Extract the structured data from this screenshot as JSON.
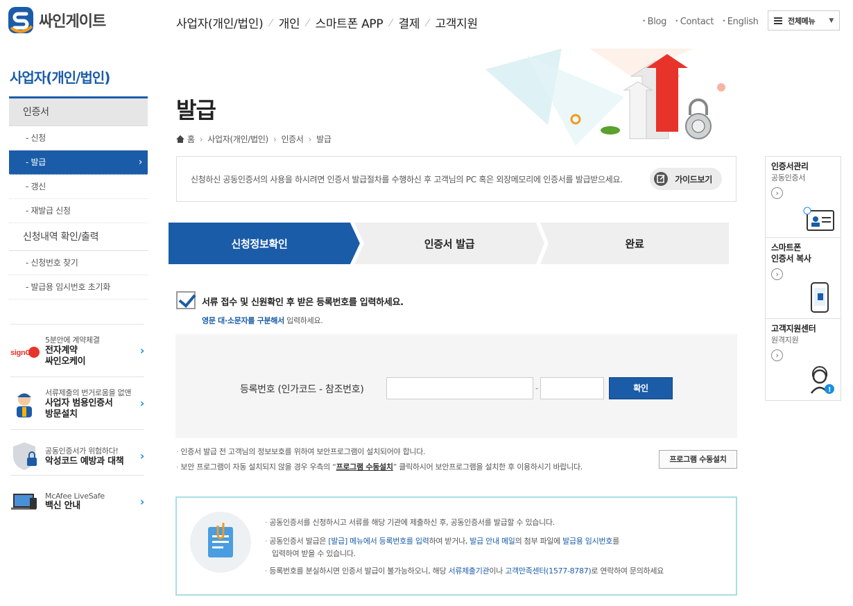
{
  "header": {
    "logo_text": "싸인게이트",
    "gnb": [
      "사업자(개인/법인)",
      "개인",
      "스마트폰 APP",
      "결제",
      "고객지원"
    ],
    "util": [
      "Blog",
      "Contact",
      "English"
    ],
    "all_menu": "전체메뉴"
  },
  "lnb": {
    "title": "사업자(개인/법인)",
    "items": [
      {
        "label": "인증서"
      },
      {
        "label": "- 신청"
      },
      {
        "label": "- 발급"
      },
      {
        "label": "- 갱신"
      },
      {
        "label": "- 재발급 신청"
      },
      {
        "label": "신청내역 확인/출력"
      },
      {
        "label": "- 신청번호 찾기"
      },
      {
        "label": "- 발급용 임시번호 초기화"
      }
    ]
  },
  "banners": [
    {
      "small": "5분안에 계약체결",
      "big1": "전자계약",
      "big2": "싸인오케이",
      "arrow": "›",
      "logo": "signOK"
    },
    {
      "small": "서류제출의 번거로움을 없앤",
      "big1": "사업자 범용인증서",
      "big2": "방문설치",
      "arrow": "›"
    },
    {
      "small": "공동인증서가 위험하다!",
      "big1": "악성코드 예방과 대책",
      "big2": "",
      "arrow": "›"
    },
    {
      "small": "McAfee LiveSafe",
      "big1": "백신 안내",
      "big2": "",
      "arrow": "›"
    }
  ],
  "main": {
    "title": "발급",
    "breadcrumb": [
      "홈",
      "사업자(개인/법인)",
      "인증서",
      "발급"
    ],
    "notice": "신청하신 공동인증서의 사용을 하시려면 인증서 발급절차를 수행하신 후 고객님의 PC 혹은 외장메모리에 인증서를 발급받으세요.",
    "guide_button": "가이드보기",
    "steps": [
      "신청정보확인",
      "인증서 발급",
      "완료"
    ],
    "instruction": "서류 접수 및 신원확인 후 받은 등록번호를 입력하세요.",
    "instruction_hl": "영문 대·소문자를 구분해서",
    "instruction_rest": " 입력하세요.",
    "reg_label": "등록번호 (인가코드 - 참조번호)",
    "dash": "-",
    "confirm": "확인",
    "note1": "인증서 발급 전 고객님의 정보보호를 위하여 보안프로그램이 설치되어야 합니다.",
    "note2a": "보안 프로그램이 자동 설치되지 않을 경우 우측의 “",
    "note2b": "프로그램 수동설치",
    "note2c": "” 클릭하시어 보안프로그램을 설치한 후 이용하시기 바랍니다.",
    "install_button": "프로그램 수동설치",
    "info": {
      "l1": "공동인증서를 신청하시고 서류를 해당 기관에 제출하신 후, 공동인증서를 발급할 수 있습니다.",
      "l2a": "공동인증서 발급은 ",
      "l2b": "[발급] 메뉴에서 등록번호를 입력",
      "l2c": "하여 받거나, ",
      "l2d": "발급 안내 메일",
      "l2e": "의 첨부 파일에 ",
      "l2f": "발급용 임시번호",
      "l2g": "를",
      "l2h": "입력하여 받을 수 있습니다.",
      "l3a": "등록번호를 분실하시면 인증서 발급이 불가능하오니, 해당 ",
      "l3b": "서류제출기관",
      "l3c": "이나 ",
      "l3d": "고객만족센터(1577-8787)",
      "l3e": "로 연락하여 문의하세요"
    }
  },
  "quick": [
    {
      "title": "인증서관리",
      "sub": "공동인증서"
    },
    {
      "title": "스마트폰\n인증서 복사",
      "title1": "스마트폰",
      "title2": "인증서 복사",
      "sub": ""
    },
    {
      "title": "고객지원센터",
      "sub": "원격지원"
    }
  ],
  "colors": {
    "primary": "#1a5ca8",
    "step_inactive": "#efefef",
    "info_border": "#a8dde4"
  }
}
